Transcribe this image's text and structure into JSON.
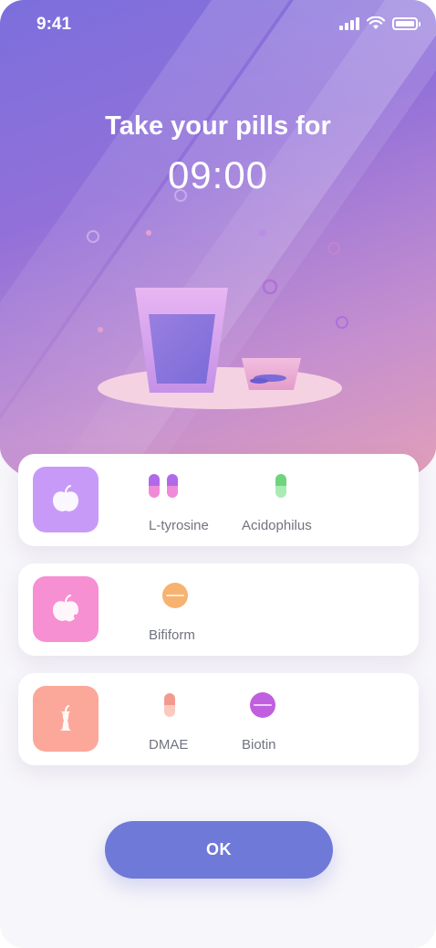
{
  "status_bar": {
    "time": "9:41",
    "icons": [
      "cellular-signal-icon",
      "wifi-icon",
      "battery-icon"
    ]
  },
  "header": {
    "title": "Take your pills for",
    "time": "09:00"
  },
  "illustration": {
    "icons": [
      "water-glass-icon",
      "pill-bowl-icon"
    ]
  },
  "schedule": [
    {
      "meal_icon": "apple-icon",
      "tile_color": "#c89af8",
      "pills": [
        {
          "label": "L-tyrosine",
          "icon": "capsule-icon",
          "colors": [
            "#b06ae8",
            "#f08ad8"
          ],
          "count": 2
        },
        {
          "label": "Acidophilus",
          "icon": "capsule-icon",
          "colors": [
            "#6fd47f",
            "#a9ecb3"
          ],
          "count": 1
        }
      ]
    },
    {
      "meal_icon": "bitten-apple-icon",
      "tile_color": "#f78fd3",
      "pills": [
        {
          "label": "Bifiform",
          "icon": "tablet-icon",
          "colors": [
            "#f7b26f"
          ],
          "count": 1
        }
      ]
    },
    {
      "meal_icon": "apple-core-icon",
      "tile_color": "#fba89a",
      "pills": [
        {
          "label": "DMAE",
          "icon": "capsule-icon",
          "colors": [
            "#f39a8f",
            "#fcc9bf"
          ],
          "count": 1
        },
        {
          "label": "Biotin",
          "icon": "tablet-icon",
          "colors": [
            "#c05fdf"
          ],
          "count": 1
        }
      ]
    }
  ],
  "actions": {
    "ok_label": "OK",
    "ok_color": "#6f79d8"
  },
  "colors": {
    "hero_gradient": [
      "#7b6fdc",
      "#9270d9",
      "#c58fcf",
      "#e7a2b4"
    ],
    "background": "#f7f6fa",
    "label_text": "#717380"
  }
}
